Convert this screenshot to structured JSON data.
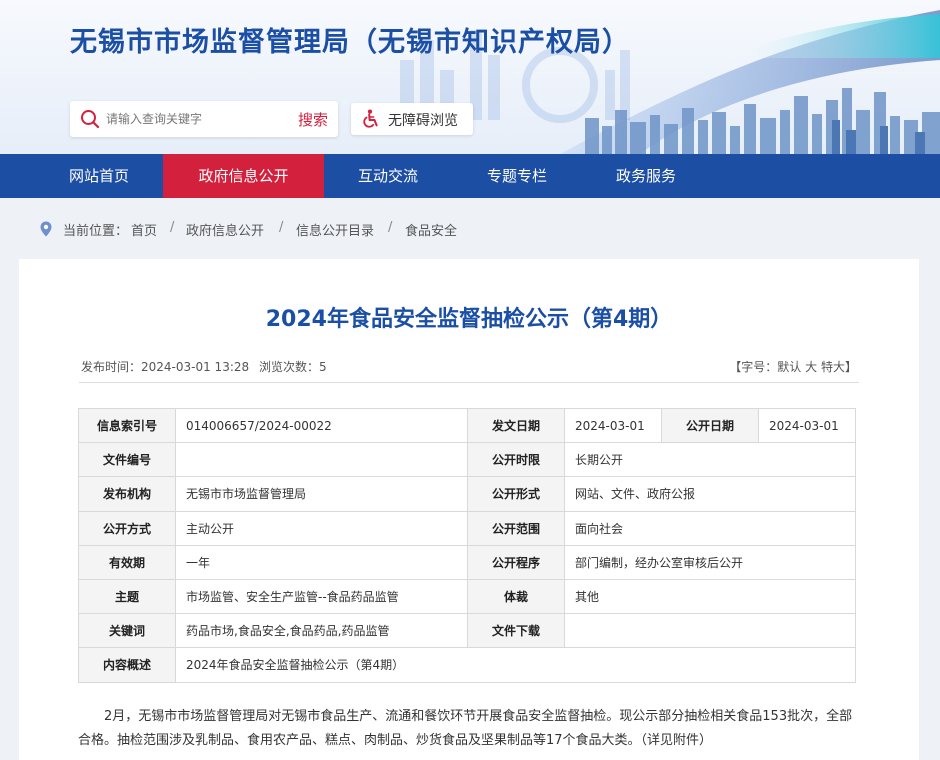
{
  "header": {
    "title": "无锡市市场监督管理局（无锡市知识产权局）",
    "search_placeholder": "请输入查询关键字",
    "search_button": "搜索",
    "accessibility_label": "无障碍浏览"
  },
  "nav": {
    "items": [
      {
        "label": "网站首页"
      },
      {
        "label": "政府信息公开"
      },
      {
        "label": "互动交流"
      },
      {
        "label": "专题专栏"
      },
      {
        "label": "政务服务"
      }
    ]
  },
  "breadcrumb": {
    "prefix": "当前位置：",
    "items": [
      "首页",
      "政府信息公开",
      "信息公开目录",
      "食品安全"
    ],
    "separator": "/"
  },
  "article": {
    "title": "2024年食品安全监督抽检公示（第4期）",
    "publish_time": "发布时间：2024-03-01 13:28",
    "views": "浏览次数：5",
    "font_size": {
      "prefix": "【字号：",
      "default": "默认",
      "large": "大",
      "xlarge": "特大",
      "suffix": "】"
    },
    "info_table": {
      "index_label": "信息索引号",
      "index_value": "014006657/2024-00022",
      "issue_date_label": "发文日期",
      "issue_date_value": "2024-03-01",
      "open_date_label": "公开日期",
      "open_date_value": "2024-03-01",
      "doc_no_label": "文件编号",
      "doc_no_value": "",
      "time_limit_label": "公开时限",
      "time_limit_value": "长期公开",
      "publisher_label": "发布机构",
      "publisher_value": "无锡市市场监督管理局",
      "form_label": "公开形式",
      "form_value": "网站、文件、政府公报",
      "method_label": "公开方式",
      "method_value": "主动公开",
      "scope_label": "公开范围",
      "scope_value": "面向社会",
      "validity_label": "有效期",
      "validity_value": "一年",
      "procedure_label": "公开程序",
      "procedure_value": "部门编制，经办公室审核后公开",
      "theme_label": "主题",
      "theme_value": "市场监管、安全生产监管--食品药品监管",
      "genre_label": "体裁",
      "genre_value": "其他",
      "keywords_label": "关键词",
      "keywords_value": "药品市场,食品安全,食品药品,药品监管",
      "download_label": "文件下载",
      "download_value": "",
      "summary_label": "内容概述",
      "summary_value": "2024年食品安全监督抽检公示（第4期）"
    },
    "body": "2月，无锡市市场监督管理局对无锡市食品生产、流通和餐饮环节开展食品安全监督抽检。现公示部分抽检相关食品153批次，全部合格。抽检范围涉及乳制品、食用农产品、糕点、肉制品、炒货食品及坚果制品等17个食品大类。（详见附件）"
  },
  "colors": {
    "brand_blue": "#1c4ea3",
    "nav_active_red": "#d3203c",
    "title_blue": "#1b4fa6"
  }
}
